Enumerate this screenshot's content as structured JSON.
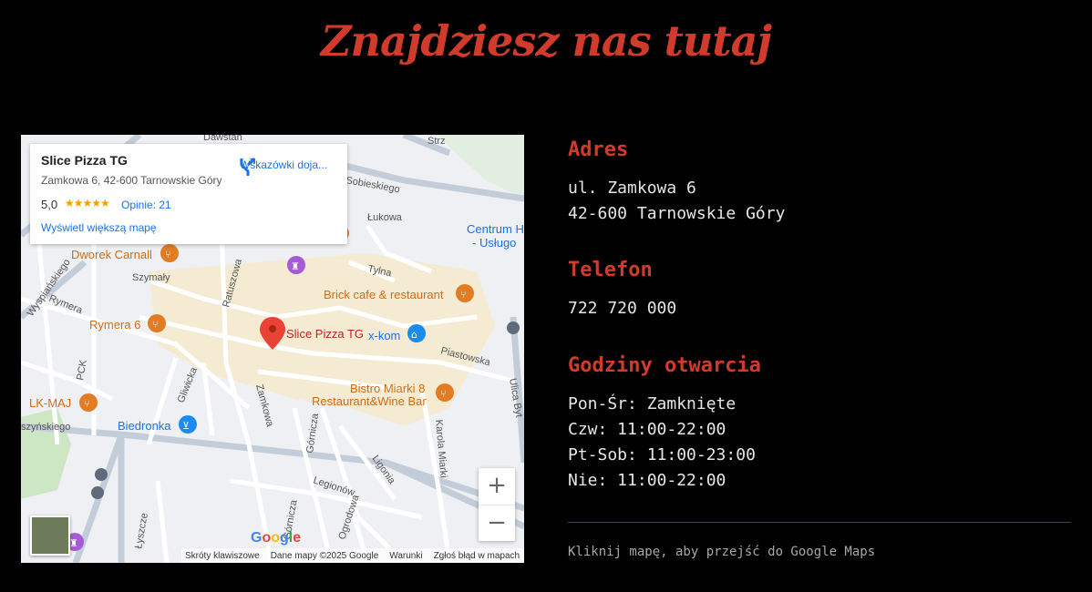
{
  "page": {
    "title": "Znajdziesz nas tutaj"
  },
  "map": {
    "card": {
      "name": "Slice Pizza TG",
      "address": "Zamkowa 6, 42-600 Tarnowskie Góry",
      "rating": "5,0",
      "stars": "★★★★★",
      "reviews": "Opinie: 21",
      "bigger_map": "Wyświetl większą mapę",
      "directions": "Wskazówki doja..."
    },
    "places": {
      "dworek": "Dworek Carnall",
      "brick": "Brick cafe & restaurant",
      "rymera6": "Rymera 6",
      "slice": "Slice Pizza TG",
      "xkom": "x-kom",
      "bistro1": "Bistro Miarki 8",
      "bistro2": "Restaurant&Wine Bar",
      "lkmaj": "LK-MAJ",
      "biedronka": "Biedronka",
      "centrum1": "Centrum H",
      "centrum2": "- Usługo"
    },
    "streets": {
      "sobieskiego": "Sobieskiego",
      "lukowa": "Łukowa",
      "tylna": "Tylna",
      "szymaly": "Szymały",
      "ratuszowa": "Ratuszowa",
      "rymera": "Rymera",
      "wyspianskiego": "Wyspiańskiego",
      "piastowska": "Piastowska",
      "gliwicka": "Gliwicka",
      "zamkowa": "Zamkowa",
      "gornicza1": "Górnicza",
      "gornicza2": "Górnicza",
      "ligonia": "Ligonia",
      "legionow": "Legionów",
      "ogrodowa": "Ogrodowa",
      "lyszcze": "Łyszcze",
      "karola": "Karola Miarki",
      "ulica": "Ulica Byt",
      "szynskiego": "szyńskiego",
      "pck": "PCK",
      "strz": "Strz",
      "dawstan": "Dawstan"
    },
    "zoom_in": "+",
    "zoom_out": "−",
    "google": "Google",
    "attribution": {
      "shortcuts": "Skróty klawiszowe",
      "data": "Dane mapy ©2025 Google",
      "terms": "Warunki",
      "report": "Zgłoś błąd w mapach"
    }
  },
  "info": {
    "address": {
      "heading": "Adres",
      "line1": "ul. Zamkowa 6",
      "line2": "42-600 Tarnowskie Góry"
    },
    "phone": {
      "heading": "Telefon",
      "number": "722 720 000"
    },
    "hours": {
      "heading": "Godziny otwarcia",
      "lines": [
        "Pon-Śr: Zamknięte",
        "Czw: 11:00-22:00",
        "Pt-Sob: 11:00-23:00",
        "Nie: 11:00-22:00"
      ]
    },
    "hint": "Kliknij mapę, aby przejść do Google Maps"
  },
  "colors": {
    "accent": "#d03b2c",
    "background": "#000000",
    "link": "#1a73e8",
    "poi": "#e37b22"
  }
}
